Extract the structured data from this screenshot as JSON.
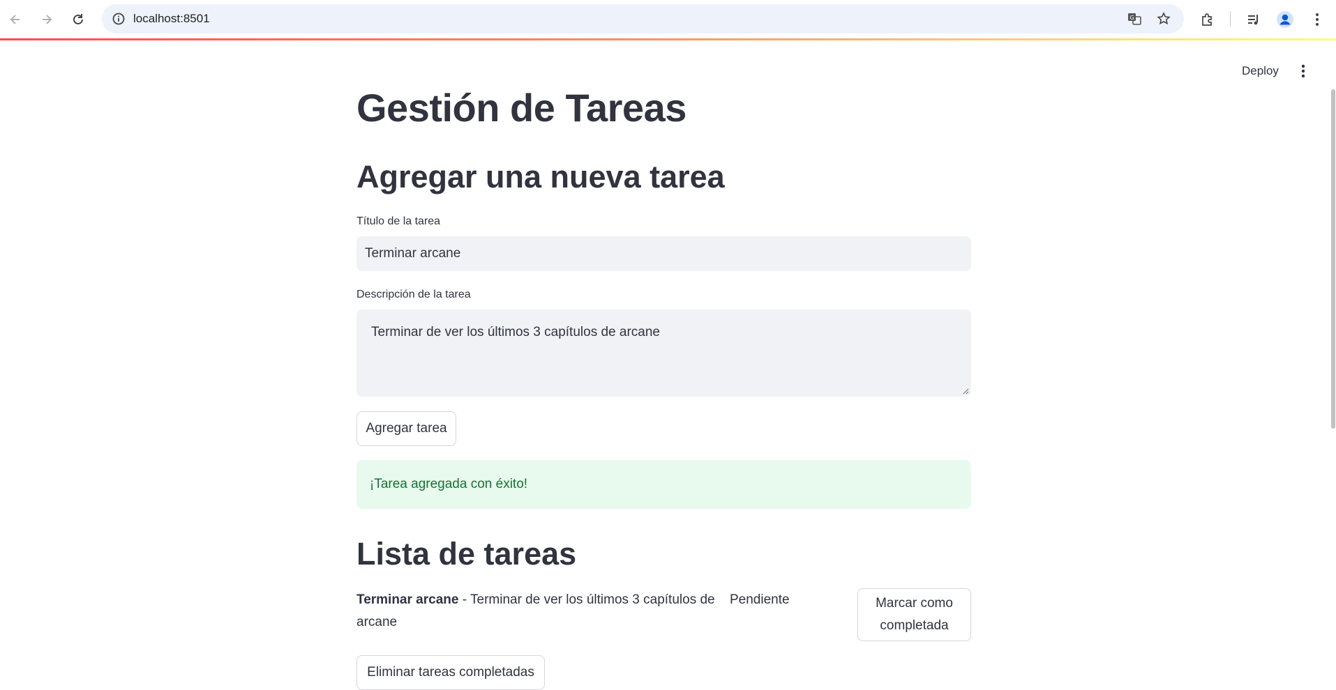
{
  "browser": {
    "url": "localhost:8501"
  },
  "header": {
    "deploy_label": "Deploy"
  },
  "page": {
    "title": "Gestión de Tareas",
    "add_section_title": "Agregar una nueva tarea",
    "title_field_label": "Título de la tarea",
    "title_field_value": "Terminar arcane",
    "description_field_label": "Descripción de la tarea",
    "description_field_value": "Terminar de ver los últimos 3 capítulos de arcane",
    "add_button_label": "Agregar tarea",
    "success_message": "¡Tarea agregada con éxito!",
    "list_section_title": "Lista de tareas",
    "tasks": [
      {
        "title": "Terminar arcane",
        "separator": " - ",
        "description": "Terminar de ver los últimos 3 capítulos de arcane",
        "status": "Pendiente",
        "action_label": "Marcar como completada"
      }
    ],
    "delete_completed_label": "Eliminar tareas completadas"
  },
  "colors": {
    "text": "#31333f",
    "input_bg": "#f0f2f6",
    "success_bg": "#e8f9ee",
    "success_text": "#177233",
    "accent": "#ff4b4b"
  }
}
